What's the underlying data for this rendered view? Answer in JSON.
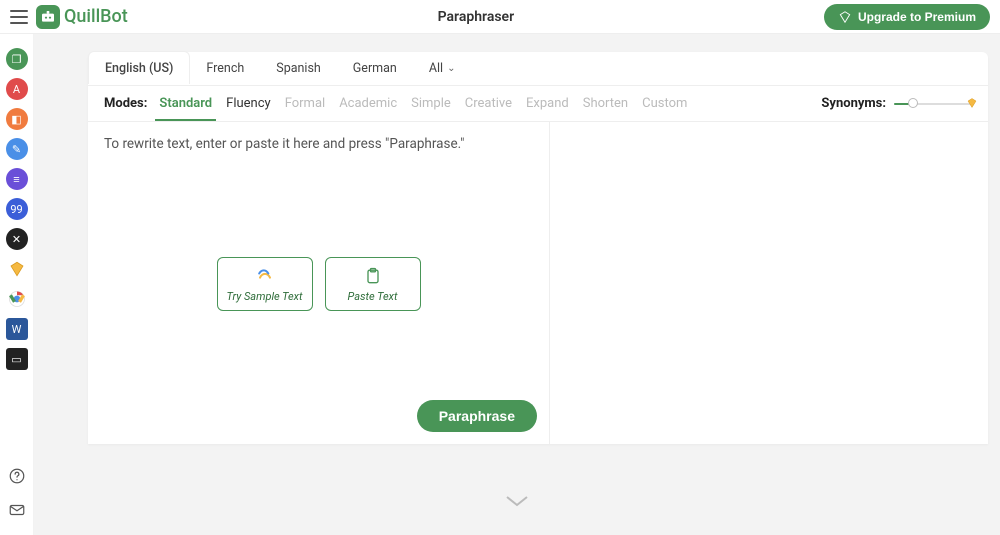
{
  "header": {
    "brand": "QuillBot",
    "title": "Paraphraser",
    "upgrade_label": "Upgrade to Premium"
  },
  "sidebar": {
    "items": [
      {
        "name": "paraphraser-icon",
        "bg": "#499557",
        "glyph": "❐"
      },
      {
        "name": "grammar-icon",
        "bg": "#e04b4b",
        "glyph": "A"
      },
      {
        "name": "plagiarism-icon",
        "bg": "#f07b3f",
        "glyph": "◧"
      },
      {
        "name": "cowriter-icon",
        "bg": "#4a8fe7",
        "glyph": "✎"
      },
      {
        "name": "summarizer-icon",
        "bg": "#6a4fd8",
        "glyph": "≡"
      },
      {
        "name": "citation-icon",
        "bg": "#3b5ed8",
        "glyph": "99"
      },
      {
        "name": "translator-icon",
        "bg": "#222222",
        "glyph": "✕"
      },
      {
        "name": "premium-icon",
        "bg": "transparent",
        "glyph": ""
      },
      {
        "name": "chrome-icon",
        "bg": "#ffffff",
        "glyph": ""
      },
      {
        "name": "word-icon",
        "bg": "#2b579a",
        "glyph": "W"
      },
      {
        "name": "macos-icon",
        "bg": "#222222",
        "glyph": "▭"
      }
    ]
  },
  "languages": {
    "tabs": [
      "English (US)",
      "French",
      "Spanish",
      "German",
      "All"
    ],
    "active": "English (US)"
  },
  "modes": {
    "label": "Modes:",
    "items": [
      {
        "label": "Standard",
        "state": "active"
      },
      {
        "label": "Fluency",
        "state": "available"
      },
      {
        "label": "Formal",
        "state": "locked"
      },
      {
        "label": "Academic",
        "state": "locked"
      },
      {
        "label": "Simple",
        "state": "locked"
      },
      {
        "label": "Creative",
        "state": "locked"
      },
      {
        "label": "Expand",
        "state": "locked"
      },
      {
        "label": "Shorten",
        "state": "locked"
      },
      {
        "label": "Custom",
        "state": "locked"
      }
    ]
  },
  "synonyms": {
    "label": "Synonyms:"
  },
  "editor": {
    "placeholder": "To rewrite text, enter or paste it here and press \"Paraphrase.\"",
    "sample_label": "Try Sample Text",
    "paste_label": "Paste Text",
    "submit_label": "Paraphrase"
  }
}
